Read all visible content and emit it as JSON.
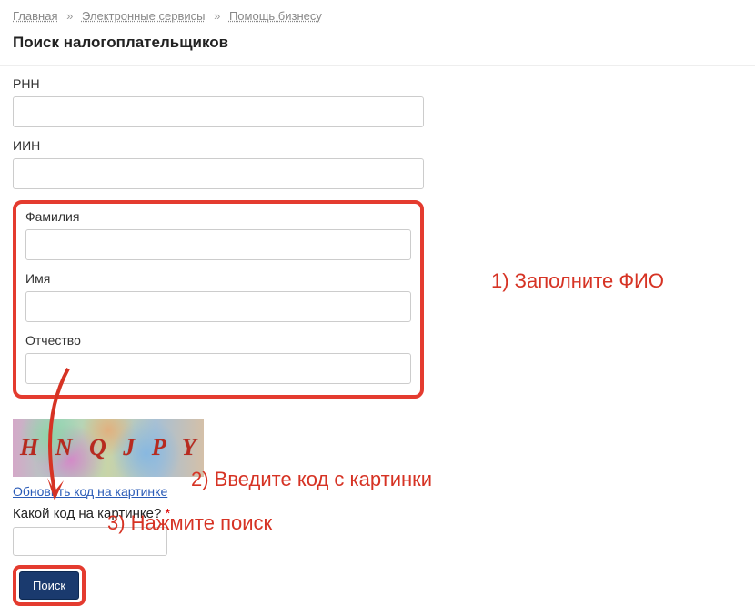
{
  "breadcrumb": {
    "home": "Главная",
    "services": "Электронные сервисы",
    "business": "Помощь бизнесу",
    "sep": "»"
  },
  "page_title": "Поиск налогоплательщиков",
  "form": {
    "rnn_label": "РНН",
    "iin_label": "ИИН",
    "surname_label": "Фамилия",
    "name_label": "Имя",
    "patronymic_label": "Отчество",
    "rnn_value": "",
    "iin_value": "",
    "surname_value": "",
    "name_value": "",
    "patronymic_value": ""
  },
  "captcha": {
    "text": "H N Q J  P Y",
    "refresh_label": "Обновить код на картинке",
    "prompt_label": "Какой код на картинке?",
    "required_mark": "*",
    "input_value": ""
  },
  "search_button": "Поиск",
  "annotations": {
    "step1": "1) Заполните ФИО",
    "step2": "2) Введите код с картинки",
    "step3": "3) Нажмите поиск"
  }
}
